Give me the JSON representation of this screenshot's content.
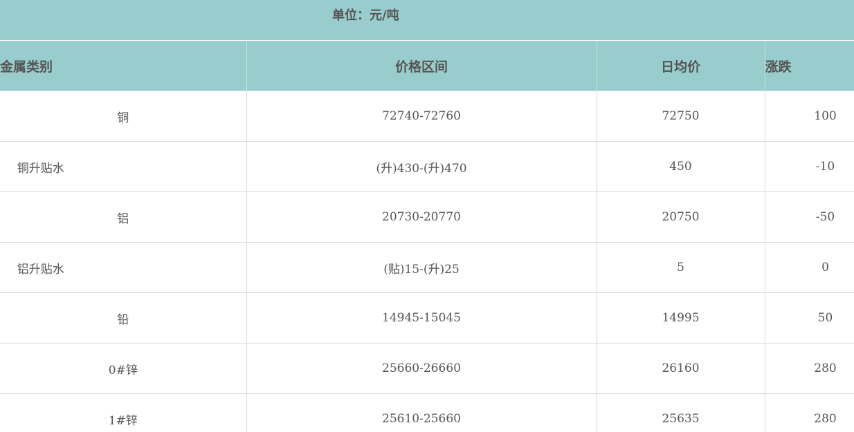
{
  "unit": "单位：元/吨",
  "table": {
    "headers": {
      "name": "金属类别",
      "range": "价格区间",
      "avg": "日均价",
      "change": "涨跌"
    },
    "rows": [
      {
        "name": "铜",
        "range": "72740-72760",
        "avg": "72750",
        "change": "100"
      },
      {
        "name": "铜升贴水",
        "range": "(升)430-(升)470",
        "avg": "450",
        "change": "-10"
      },
      {
        "name": "铝",
        "range": "20730-20770",
        "avg": "20750",
        "change": "-50"
      },
      {
        "name": "铝升贴水",
        "range": "(贴)15-(升)25",
        "avg": "5",
        "change": "0"
      },
      {
        "name": "铅",
        "range": "14945-15045",
        "avg": "14995",
        "change": "50"
      },
      {
        "name": "0#锌",
        "range": "25660-26660",
        "avg": "26160",
        "change": "280"
      },
      {
        "name": "1#锌",
        "range": "25610-25660",
        "avg": "25635",
        "change": "280"
      }
    ]
  }
}
